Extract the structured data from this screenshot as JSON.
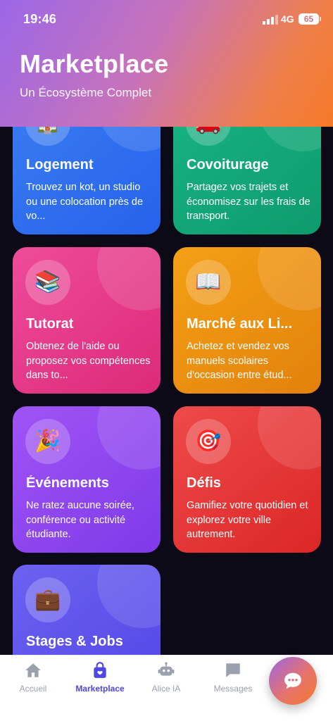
{
  "status": {
    "time": "19:46",
    "network": "4G",
    "battery": "65"
  },
  "header": {
    "title": "Marketplace",
    "subtitle": "Un Écosystème Complet"
  },
  "cards": [
    {
      "key": "logement",
      "emoji": "🏠",
      "title": "Logement",
      "desc": "Trouvez un kot, un studio ou une colocation près de vo..."
    },
    {
      "key": "covoiturage",
      "emoji": "🚗",
      "title": "Covoiturage",
      "desc": "Partagez vos trajets et économisez sur les frais de transport."
    },
    {
      "key": "tutorat",
      "emoji": "📚",
      "title": "Tutorat",
      "desc": "Obtenez de l'aide ou proposez vos compétences dans to..."
    },
    {
      "key": "livres",
      "emoji": "📖",
      "title": "Marché aux Li...",
      "desc": "Achetez et vendez vos manuels scolaires d'occasion entre étud..."
    },
    {
      "key": "evenements",
      "emoji": "🎉",
      "title": "Événements",
      "desc": "Ne ratez aucune soirée, conférence ou activité étudiante."
    },
    {
      "key": "defis",
      "emoji": "🎯",
      "title": "Défis",
      "desc": "Gamifiez votre quotidien et explorez votre ville autrement."
    },
    {
      "key": "stages",
      "emoji": "💼",
      "title": "Stages & Jobs",
      "desc": ""
    }
  ],
  "nav": {
    "accueil": "Accueil",
    "marketplace": "Marketplace",
    "alice": "Alice IA",
    "messages": "Messages"
  },
  "colors": {
    "accent": "#4f46e5",
    "inactive": "#9aa0ad"
  },
  "icons": {
    "nav": [
      "home-icon",
      "shopping-bag-icon",
      "robot-icon",
      "chat-bubble-icon"
    ],
    "fab": "chat-fab-icon"
  }
}
